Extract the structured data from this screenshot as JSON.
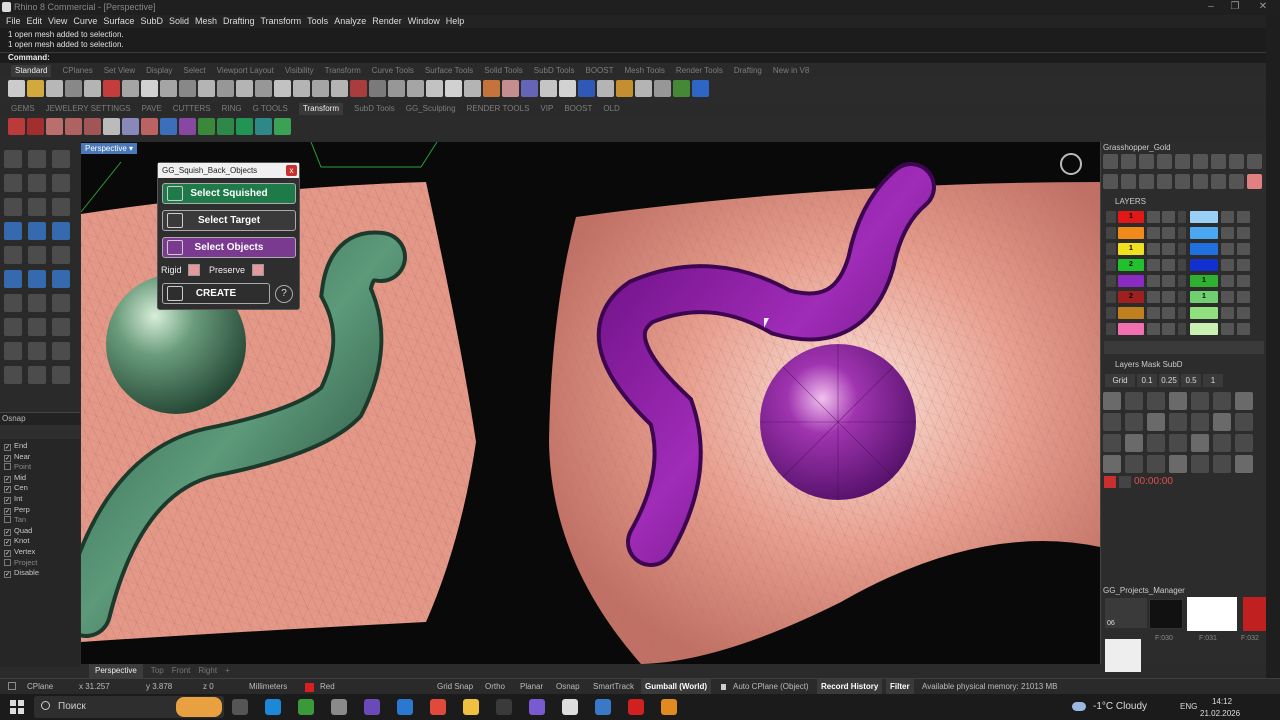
{
  "window": {
    "title": "Rhino 8 Commercial - [Perspective]"
  },
  "menu": [
    "File",
    "Edit",
    "View",
    "Curve",
    "Surface",
    "SubD",
    "Solid",
    "Mesh",
    "Drafting",
    "Transform",
    "Tools",
    "Analyze",
    "Render",
    "Window",
    "Help"
  ],
  "command_history": [
    "1 open mesh added to selection.",
    "1 open mesh added to selection."
  ],
  "command_prompt": "Command:",
  "toolbar_tabs_1": [
    "Standard",
    "CPlanes",
    "Set View",
    "Display",
    "Select",
    "Viewport Layout",
    "Visibility",
    "Transform",
    "Curve Tools",
    "Surface Tools",
    "Solid Tools",
    "SubD Tools",
    "BOOST",
    "Mesh Tools",
    "Render Tools",
    "Drafting",
    "New in V8"
  ],
  "toolbar_tabs_2": [
    "GEMS",
    "JEWELERY SETTINGS",
    "PAVE",
    "CUTTERS",
    "RING",
    "G TOOLS",
    "Transform",
    "SubD Tools",
    "GG_Sculpting",
    "RENDER TOOLS",
    "VIP",
    "BOOST",
    "OLD"
  ],
  "active_tab_1": "Standard",
  "active_tab_2": "Transform",
  "viewport": {
    "label": "Perspective ▾",
    "tabs": [
      "Perspective",
      "Top",
      "Front",
      "Right",
      "+"
    ]
  },
  "panel": {
    "title": "GG_Squish_Back_Objects",
    "close": "x",
    "btn_squished": "Select Squished",
    "btn_target": "Select Target",
    "btn_objects": "Select Objects",
    "rigid": "Rigid",
    "preserve": "Preserve",
    "create": "CREATE",
    "help": "?"
  },
  "osnap": {
    "header": "Osnap",
    "items": [
      {
        "label": "End",
        "on": true
      },
      {
        "label": "Near",
        "on": true
      },
      {
        "label": "Point",
        "on": false
      },
      {
        "label": "Mid",
        "on": true
      },
      {
        "label": "Cen",
        "on": true
      },
      {
        "label": "Int",
        "on": true
      },
      {
        "label": "Perp",
        "on": true
      },
      {
        "label": "Tan",
        "on": false
      },
      {
        "label": "Quad",
        "on": true
      },
      {
        "label": "Knot",
        "on": true
      },
      {
        "label": "Vertex",
        "on": true
      },
      {
        "label": "Project",
        "on": false
      },
      {
        "label": "Disable",
        "on": true
      }
    ]
  },
  "right": {
    "grasshopper": "Grasshopper_Gold",
    "layers_header": "LAYERS",
    "layers_mask": "Layers Mask SubD",
    "grid_label": "Grid",
    "grid_vals": [
      "0.1",
      "0.25",
      "0.5",
      "1"
    ],
    "timer": "00:00:00",
    "projects": "GG_Projects_Manager",
    "project_num": "06",
    "thumbs": [
      "F:030",
      "F:031",
      "F:032"
    ]
  },
  "layers": [
    {
      "color": "#e01818",
      "num": "1",
      "ltint": "#9ad0f8",
      "lnum": ""
    },
    {
      "color": "#f08a1a",
      "num": "",
      "ltint": "#4aa8f0",
      "lnum": ""
    },
    {
      "color": "#f0e020",
      "num": "1",
      "ltint": "#2070e0",
      "lnum": ""
    },
    {
      "color": "#22c02a",
      "num": "2",
      "ltint": "#1030d0",
      "lnum": ""
    },
    {
      "color": "#8a2cc0",
      "num": "",
      "ltint": "#30b030",
      "lnum": "1"
    },
    {
      "color": "#a02020",
      "num": "2",
      "ltint": "#70d070",
      "lnum": "1"
    },
    {
      "color": "#c08020",
      "num": "",
      "ltint": "#90e080",
      "lnum": ""
    },
    {
      "color": "#f070b0",
      "num": "",
      "ltint": "#c8f0b0",
      "lnum": ""
    }
  ],
  "status": {
    "cplane": "CPlane",
    "x": "x 31.257",
    "y": "y 3.878",
    "z": "z 0",
    "units": "Millimeters",
    "layer": "Red",
    "layer_color": "#d82020",
    "grid_snap": "Grid Snap",
    "ortho": "Ortho",
    "planar": "Planar",
    "osnap": "Osnap",
    "smarttrack": "SmartTrack",
    "gumball": "Gumball (World)",
    "autocplane": "Auto CPlane (Object)",
    "record": "Record History",
    "filter": "Filter",
    "memory": "Available physical memory: 21013 MB"
  },
  "taskbar": {
    "search": "Поиск",
    "weather": "-1°C  Cloudy",
    "lang": "ENG",
    "time": "14:12",
    "date": "21.02.2026"
  },
  "colors": {
    "surface": "#e89a8a",
    "green_obj": "#3e7c5c",
    "purple_obj": "#8a1e9e",
    "panel_green": "#1f7a4a",
    "panel_purple": "#7a3a90"
  }
}
